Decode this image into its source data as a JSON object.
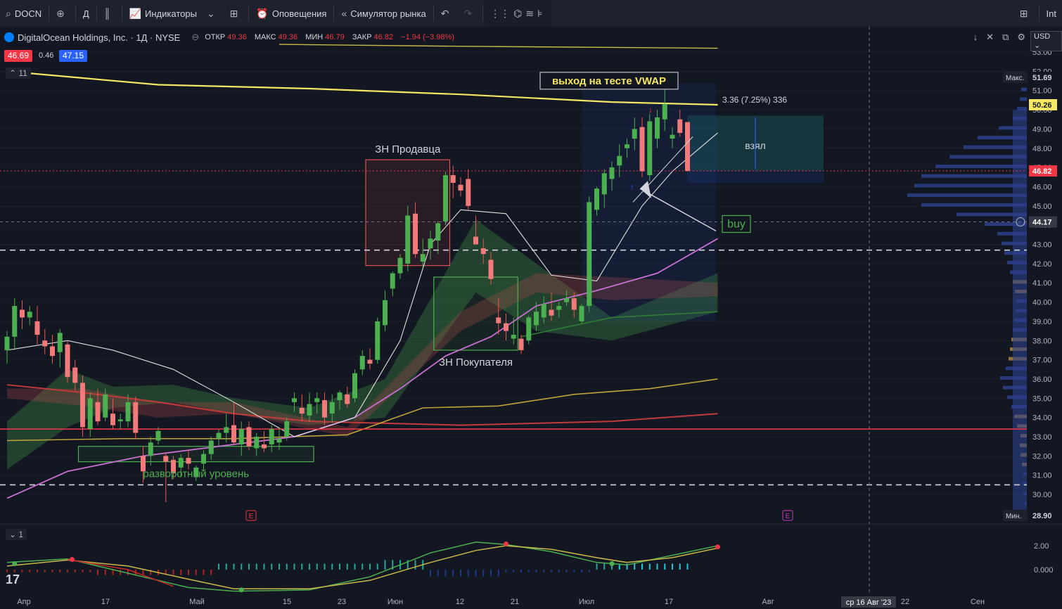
{
  "toolbar": {
    "symbol": "DOCN",
    "interval": "Д",
    "indicators": "Индикаторы",
    "alerts": "Оповещения",
    "replay": "Симулятор рынка",
    "right_text": "Int"
  },
  "legend": {
    "title": "DigitalOcean Holdings, Inc. · 1Д · NYSE",
    "open_label": "ОТКР",
    "open": "49.36",
    "high_label": "МАКС",
    "high": "49.36",
    "low_label": "МИН",
    "low": "46.79",
    "close_label": "ЗАКР",
    "close": "46.82",
    "change": "−1.94 (−3.98%)",
    "bid": "46.69",
    "spread": "0.46",
    "ask": "47.15",
    "collapse": "11",
    "indicator_pane": "1"
  },
  "currency": "USD",
  "colors": {
    "bg": "#131722",
    "up": "#4caf50",
    "down": "#ef5350",
    "vwap": "#f5e663",
    "red_level": "#f23645",
    "ma_pink": "#c770d0",
    "green_zone": "#4caf50",
    "volume_profile": "#2d3f8c",
    "vp_hvn": "#a8843c"
  },
  "chart_data": {
    "type": "candlestick",
    "title": "DigitalOcean Holdings, Inc. · 1Д · NYSE",
    "ylim": [
      28.5,
      53.5
    ],
    "y_ticks": [
      30,
      31,
      32,
      33,
      34,
      35,
      36,
      37,
      38,
      39,
      40,
      41,
      42,
      43,
      44,
      45,
      46,
      47,
      48,
      49,
      50,
      51,
      52,
      53
    ],
    "x_tick_labels": [
      "Апр",
      "17",
      "Май",
      "15",
      "23",
      "Июн",
      "12",
      "21",
      "Июл",
      "17",
      "Авг",
      "22",
      "Сен"
    ],
    "candles": [
      {
        "o": 37.5,
        "h": 38.5,
        "l": 36.8,
        "c": 38.2
      },
      {
        "o": 38.2,
        "h": 40.2,
        "l": 37.5,
        "c": 39.8
      },
      {
        "o": 39.6,
        "h": 40.1,
        "l": 38.6,
        "c": 39.2
      },
      {
        "o": 39.2,
        "h": 39.8,
        "l": 38.8,
        "c": 39.5
      },
      {
        "o": 39.0,
        "h": 39.8,
        "l": 37.8,
        "c": 38.3
      },
      {
        "o": 38.0,
        "h": 38.6,
        "l": 37.3,
        "c": 37.7
      },
      {
        "o": 37.7,
        "h": 38.3,
        "l": 36.8,
        "c": 37.2
      },
      {
        "o": 37.4,
        "h": 38.6,
        "l": 36.6,
        "c": 38.4
      },
      {
        "o": 37.8,
        "h": 38.0,
        "l": 35.8,
        "c": 36.1
      },
      {
        "o": 36.6,
        "h": 37.0,
        "l": 35.4,
        "c": 35.8
      },
      {
        "o": 35.8,
        "h": 36.2,
        "l": 33.0,
        "c": 33.5
      },
      {
        "o": 33.4,
        "h": 35.3,
        "l": 33.0,
        "c": 35.0
      },
      {
        "o": 34.8,
        "h": 35.5,
        "l": 33.6,
        "c": 33.8
      },
      {
        "o": 34.0,
        "h": 35.5,
        "l": 33.8,
        "c": 35.2
      },
      {
        "o": 34.2,
        "h": 35.0,
        "l": 33.4,
        "c": 33.6
      },
      {
        "o": 33.8,
        "h": 34.2,
        "l": 33.4,
        "c": 33.9
      },
      {
        "o": 33.8,
        "h": 35.2,
        "l": 33.5,
        "c": 34.8
      },
      {
        "o": 34.8,
        "h": 35.1,
        "l": 32.9,
        "c": 33.2
      },
      {
        "o": 32.0,
        "h": 32.5,
        "l": 30.6,
        "c": 31.2
      },
      {
        "o": 32.0,
        "h": 33.0,
        "l": 31.5,
        "c": 32.7
      },
      {
        "o": 32.8,
        "h": 33.5,
        "l": 32.6,
        "c": 33.3
      },
      {
        "o": 32.0,
        "h": 32.2,
        "l": 29.6,
        "c": 31.7
      },
      {
        "o": 31.8,
        "h": 32.0,
        "l": 30.8,
        "c": 31.1
      },
      {
        "o": 31.4,
        "h": 32.1,
        "l": 30.9,
        "c": 31.9
      },
      {
        "o": 31.9,
        "h": 32.3,
        "l": 31.3,
        "c": 31.6
      },
      {
        "o": 30.9,
        "h": 31.5,
        "l": 30.7,
        "c": 31.4
      },
      {
        "o": 31.6,
        "h": 32.3,
        "l": 31.2,
        "c": 32.1
      },
      {
        "o": 32.1,
        "h": 33.0,
        "l": 31.8,
        "c": 32.8
      },
      {
        "o": 32.9,
        "h": 33.4,
        "l": 32.5,
        "c": 33.2
      },
      {
        "o": 33.2,
        "h": 34.2,
        "l": 32.7,
        "c": 33.5
      },
      {
        "o": 33.6,
        "h": 34.8,
        "l": 32.6,
        "c": 32.7
      },
      {
        "o": 32.6,
        "h": 33.8,
        "l": 32.0,
        "c": 33.4
      },
      {
        "o": 33.5,
        "h": 33.8,
        "l": 32.3,
        "c": 32.5
      },
      {
        "o": 32.4,
        "h": 33.2,
        "l": 32.0,
        "c": 33.0
      },
      {
        "o": 32.6,
        "h": 33.3,
        "l": 32.2,
        "c": 32.4
      },
      {
        "o": 32.6,
        "h": 33.6,
        "l": 32.2,
        "c": 33.4
      },
      {
        "o": 32.7,
        "h": 33.5,
        "l": 32.3,
        "c": 32.9
      },
      {
        "o": 33.0,
        "h": 34.0,
        "l": 32.8,
        "c": 33.8
      },
      {
        "o": 34.8,
        "h": 35.3,
        "l": 34.3,
        "c": 35.0
      },
      {
        "o": 34.5,
        "h": 35.2,
        "l": 33.8,
        "c": 34.2
      },
      {
        "o": 34.1,
        "h": 35.3,
        "l": 33.8,
        "c": 34.7
      },
      {
        "o": 34.8,
        "h": 35.3,
        "l": 34.2,
        "c": 35.0
      },
      {
        "o": 34.9,
        "h": 35.3,
        "l": 33.6,
        "c": 34.0
      },
      {
        "o": 34.2,
        "h": 35.2,
        "l": 33.7,
        "c": 34.8
      },
      {
        "o": 34.9,
        "h": 35.4,
        "l": 34.4,
        "c": 35.3
      },
      {
        "o": 35.2,
        "h": 35.6,
        "l": 34.5,
        "c": 34.7
      },
      {
        "o": 35.0,
        "h": 36.5,
        "l": 34.8,
        "c": 36.3
      },
      {
        "o": 36.5,
        "h": 37.5,
        "l": 36.2,
        "c": 37.2
      },
      {
        "o": 37.0,
        "h": 37.6,
        "l": 36.5,
        "c": 36.8
      },
      {
        "o": 37.0,
        "h": 39.2,
        "l": 36.8,
        "c": 39.0
      },
      {
        "o": 38.8,
        "h": 40.6,
        "l": 38.5,
        "c": 40.1
      },
      {
        "o": 40.7,
        "h": 41.6,
        "l": 40.3,
        "c": 41.5
      },
      {
        "o": 41.5,
        "h": 42.5,
        "l": 41.2,
        "c": 42.3
      },
      {
        "o": 42.0,
        "h": 45.0,
        "l": 41.6,
        "c": 44.5
      },
      {
        "o": 44.6,
        "h": 45.2,
        "l": 42.3,
        "c": 42.5
      },
      {
        "o": 42.1,
        "h": 43.3,
        "l": 41.8,
        "c": 42.5
      },
      {
        "o": 42.8,
        "h": 43.7,
        "l": 42.2,
        "c": 43.3
      },
      {
        "o": 43.2,
        "h": 44.2,
        "l": 42.5,
        "c": 44.1
      },
      {
        "o": 44.2,
        "h": 46.8,
        "l": 44.0,
        "c": 46.6
      },
      {
        "o": 46.6,
        "h": 47.1,
        "l": 45.4,
        "c": 46.2
      },
      {
        "o": 46.1,
        "h": 46.5,
        "l": 45.5,
        "c": 45.8
      },
      {
        "o": 46.4,
        "h": 46.9,
        "l": 44.8,
        "c": 45.0
      },
      {
        "o": 43.4,
        "h": 44.5,
        "l": 43.1,
        "c": 43.0
      },
      {
        "o": 42.8,
        "h": 43.3,
        "l": 42.0,
        "c": 42.5
      },
      {
        "o": 42.2,
        "h": 42.6,
        "l": 40.9,
        "c": 41.2
      },
      {
        "o": 39.2,
        "h": 40.2,
        "l": 38.3,
        "c": 38.9
      },
      {
        "o": 38.9,
        "h": 39.4,
        "l": 38.0,
        "c": 38.5
      },
      {
        "o": 38.1,
        "h": 39.2,
        "l": 37.8,
        "c": 38.3
      },
      {
        "o": 38.1,
        "h": 38.3,
        "l": 37.3,
        "c": 37.5
      },
      {
        "o": 38.0,
        "h": 39.3,
        "l": 37.8,
        "c": 39.2
      },
      {
        "o": 38.8,
        "h": 40.0,
        "l": 38.5,
        "c": 39.5
      },
      {
        "o": 39.2,
        "h": 40.3,
        "l": 38.9,
        "c": 39.9
      },
      {
        "o": 39.6,
        "h": 40.5,
        "l": 39.0,
        "c": 39.3
      },
      {
        "o": 39.6,
        "h": 40.0,
        "l": 39.2,
        "c": 39.8
      },
      {
        "o": 40.0,
        "h": 40.6,
        "l": 39.8,
        "c": 40.2
      },
      {
        "o": 40.2,
        "h": 40.5,
        "l": 39.2,
        "c": 39.6
      },
      {
        "o": 39.0,
        "h": 39.9,
        "l": 38.9,
        "c": 39.8
      },
      {
        "o": 39.8,
        "h": 45.5,
        "l": 39.5,
        "c": 45.2
      },
      {
        "o": 44.8,
        "h": 46.0,
        "l": 44.5,
        "c": 45.9
      },
      {
        "o": 45.6,
        "h": 46.9,
        "l": 44.9,
        "c": 46.7
      },
      {
        "o": 46.4,
        "h": 47.3,
        "l": 45.8,
        "c": 47.0
      },
      {
        "o": 47.1,
        "h": 48.2,
        "l": 46.5,
        "c": 47.6
      },
      {
        "o": 48.0,
        "h": 48.5,
        "l": 47.5,
        "c": 48.2
      },
      {
        "o": 48.5,
        "h": 49.6,
        "l": 47.9,
        "c": 49.0
      },
      {
        "o": 49.1,
        "h": 49.6,
        "l": 46.5,
        "c": 46.8
      },
      {
        "o": 46.6,
        "h": 49.8,
        "l": 46.3,
        "c": 49.4
      },
      {
        "o": 48.5,
        "h": 50.0,
        "l": 48.0,
        "c": 49.6
      },
      {
        "o": 49.5,
        "h": 51.6,
        "l": 48.9,
        "c": 50.3
      },
      {
        "o": 48.5,
        "h": 49.1,
        "l": 48.0,
        "c": 48.7
      },
      {
        "o": 49.5,
        "h": 50.0,
        "l": 48.6,
        "c": 48.8
      },
      {
        "o": 49.36,
        "h": 49.36,
        "l": 46.79,
        "c": 46.82
      }
    ],
    "price_axis_labels": [
      {
        "tag": "Макс.",
        "value": "51.69"
      },
      {
        "tag": "",
        "value": "50.26"
      },
      {
        "tag": "",
        "value": "46.82"
      },
      {
        "tag": "",
        "value": "44.17"
      },
      {
        "tag": "Мин.",
        "value": "28.90"
      }
    ],
    "levels": [
      {
        "price": 33.4,
        "style": "solid",
        "color": "#f23645"
      },
      {
        "price": 42.7,
        "style": "dashed",
        "color": "#d1d4dc"
      },
      {
        "price": 30.5,
        "style": "dashed",
        "color": "#d1d4dc"
      },
      {
        "price": 46.82,
        "style": "dotted",
        "color": "#f23645"
      }
    ],
    "zones": [
      {
        "label": "ЗН Продавца",
        "x0": 48,
        "x1": 58,
        "y0": 41.9,
        "y1": 47.4,
        "type": "supply"
      },
      {
        "label": "ЗН Покупателя",
        "x0": 57,
        "x1": 67,
        "y0": 37.5,
        "y1": 41.3,
        "type": "demand"
      },
      {
        "label": "разворотный уровень",
        "x0": 10,
        "x1": 40,
        "y0": 31.7,
        "y1": 32.5,
        "type": "level"
      }
    ],
    "annotations": {
      "vwap_exit": "выход на тесте VWAP",
      "buy": "buy",
      "took": "взял",
      "position_stats": "3.36 (7.25%) 336"
    },
    "oscillator": {
      "y_ticks": [
        "2.00",
        "0.000"
      ]
    },
    "date_tooltip": "ср 16 Авг '23"
  }
}
